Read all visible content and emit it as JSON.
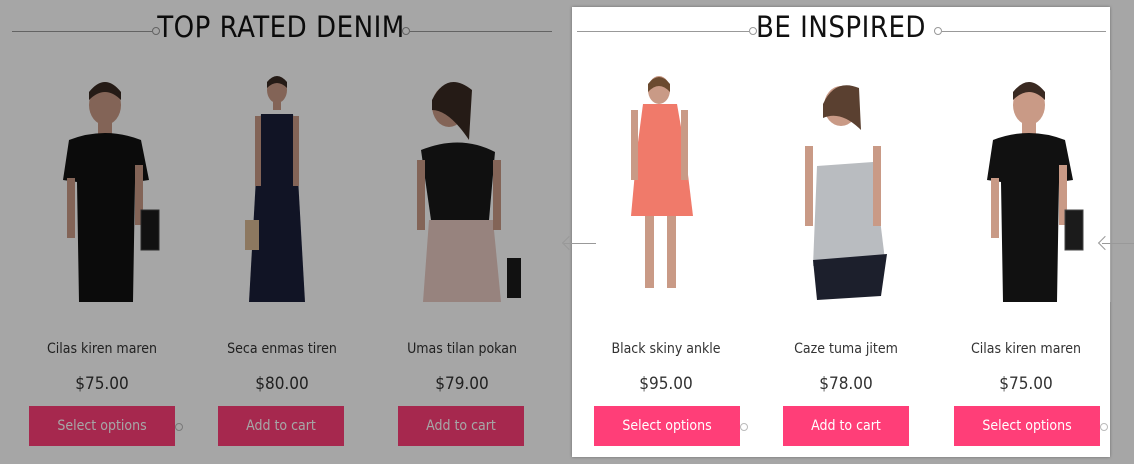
{
  "colors": {
    "button_primary": "#ff3e78",
    "button_dimmed": "#b5002e"
  },
  "left_section": {
    "title": "TOP RATED DENIM",
    "products": [
      {
        "name": "Cilas kiren maren",
        "price": "$75.00",
        "button": "Select options",
        "image": "woman-black-dress-bag",
        "dress": "#111111"
      },
      {
        "name": "Seca enmas tiren",
        "price": "$80.00",
        "button": "Add to cart",
        "image": "woman-navy-maxi-dress",
        "dress": "#1b1f3a"
      },
      {
        "name": "Umas tilan pokan",
        "price": "$79.00",
        "button": "Add to cart",
        "image": "woman-black-top-pink-skirt",
        "dress": "#1a1a1a"
      }
    ]
  },
  "right_section": {
    "title": "BE INSPIRED",
    "products": [
      {
        "name": "Black skiny ankle",
        "price": "$95.00",
        "button": "Select options",
        "image": "woman-coral-lace-dress",
        "dress": "#f07a6a"
      },
      {
        "name": "Caze tuma jitem",
        "price": "$78.00",
        "button": "Add to cart",
        "image": "woman-grey-top-black-shorts",
        "dress": "#b9bcc0"
      },
      {
        "name": "Cilas kiren maren",
        "price": "$75.00",
        "button": "Select options",
        "image": "woman-black-dress-bag",
        "dress": "#111111"
      }
    ]
  }
}
